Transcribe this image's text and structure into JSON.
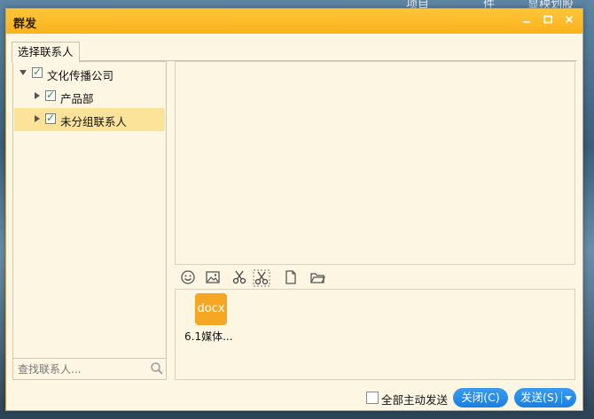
{
  "desktop": {
    "fragments": [
      "项目",
      "件",
      "显秧划股"
    ]
  },
  "dialog": {
    "title": "群发",
    "tab_label": "选择联系人"
  },
  "tree": {
    "root": {
      "label": "文化传播公司",
      "checked": true,
      "expanded": true
    },
    "children": [
      {
        "label": "产品部",
        "checked": true,
        "expanded": false
      },
      {
        "label": "未分组联系人",
        "checked": true,
        "expanded": false,
        "selected": true
      }
    ]
  },
  "search": {
    "placeholder": "查找联系人..."
  },
  "toolbar": {
    "icons": [
      "emoji-icon",
      "image-icon",
      "scissors-icon",
      "screenshot-icon",
      "file-icon",
      "folder-icon"
    ]
  },
  "attachment": {
    "icon_text": "docx",
    "name": "6.1媒体..."
  },
  "footer": {
    "send_all_label": "全部主动发送",
    "send_all_checked": false,
    "close_label": "关闭(C)",
    "send_label": "发送(S)"
  },
  "colors": {
    "titlebar": "#fbb21b",
    "background": "#fdf6e3",
    "selected_row": "#fbe39a",
    "button": "#1a7fe0",
    "file_icon": "#f5a623"
  }
}
